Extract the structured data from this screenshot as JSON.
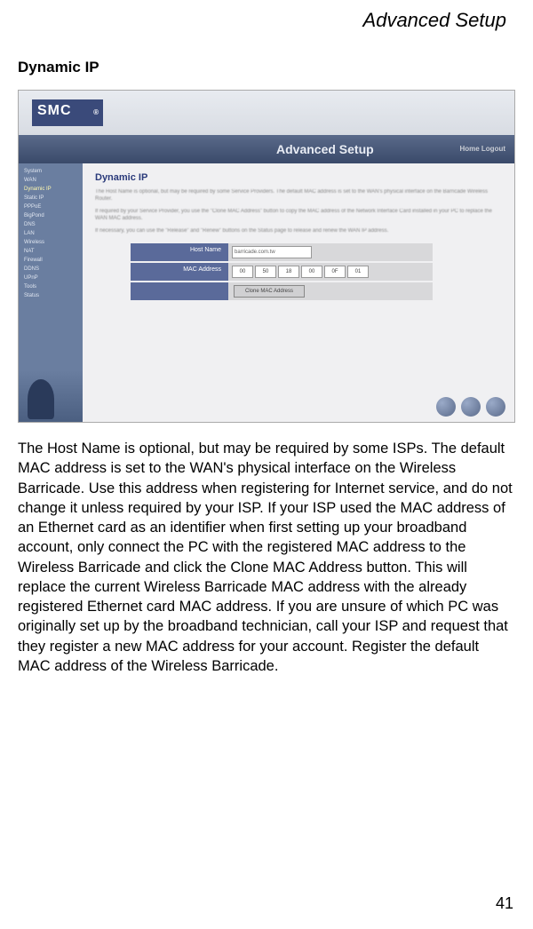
{
  "page": {
    "header": "Advanced Setup",
    "section_title": "Dynamic IP",
    "body_text": "The Host Name is optional, but may be required by some ISPs. The default MAC address is set to the WAN's physical interface on the Wireless Barricade. Use this address when registering for Internet service, and do not change it unless required by your ISP. If your ISP used the MAC address of an Ethernet card as an identifier when first setting up your broadband account, only connect the PC with the registered MAC address to the Wireless Barricade and click the Clone MAC Address button. This will replace the current Wireless Barricade MAC address with the already registered Ethernet card MAC address. If you are unsure of which PC was originally set up by the broadband technician, call your ISP and request that they register a new MAC address for your account. Register the default MAC address of the Wireless Barricade.",
    "page_number": "41"
  },
  "screenshot": {
    "logo": "SMC",
    "banner": "Advanced Setup",
    "banner_right": "Home  Logout",
    "sidebar": {
      "items": [
        "System",
        "WAN",
        "Dynamic IP",
        "Static IP",
        "PPPoE",
        "BigPond",
        "DNS",
        "LAN",
        "Wireless",
        "NAT",
        "Firewall",
        "DDNS",
        "UPnP",
        "Tools",
        "Status"
      ]
    },
    "panel_title": "Dynamic IP",
    "desc1": "The Host Name is optional, but may be required by some Service Providers. The default MAC address is set to the WAN's physical interface on the Barricade Wireless Router.",
    "desc2": "If required by your Service Provider, you use the \"Clone MAC Address\" button to copy the MAC address of the Network Interface Card installed in your PC to replace the WAN MAC address.",
    "desc3": "If necessary, you can use the \"Release\" and \"Renew\" buttons on the Status page to release and renew the WAN IP address.",
    "form": {
      "host_label": "Host Name",
      "host_value": "barricade.com.tw",
      "mac_label": "MAC Address",
      "mac": [
        "00",
        "50",
        "18",
        "00",
        "0F",
        "01"
      ],
      "clone_btn": "Clone MAC Address"
    }
  }
}
